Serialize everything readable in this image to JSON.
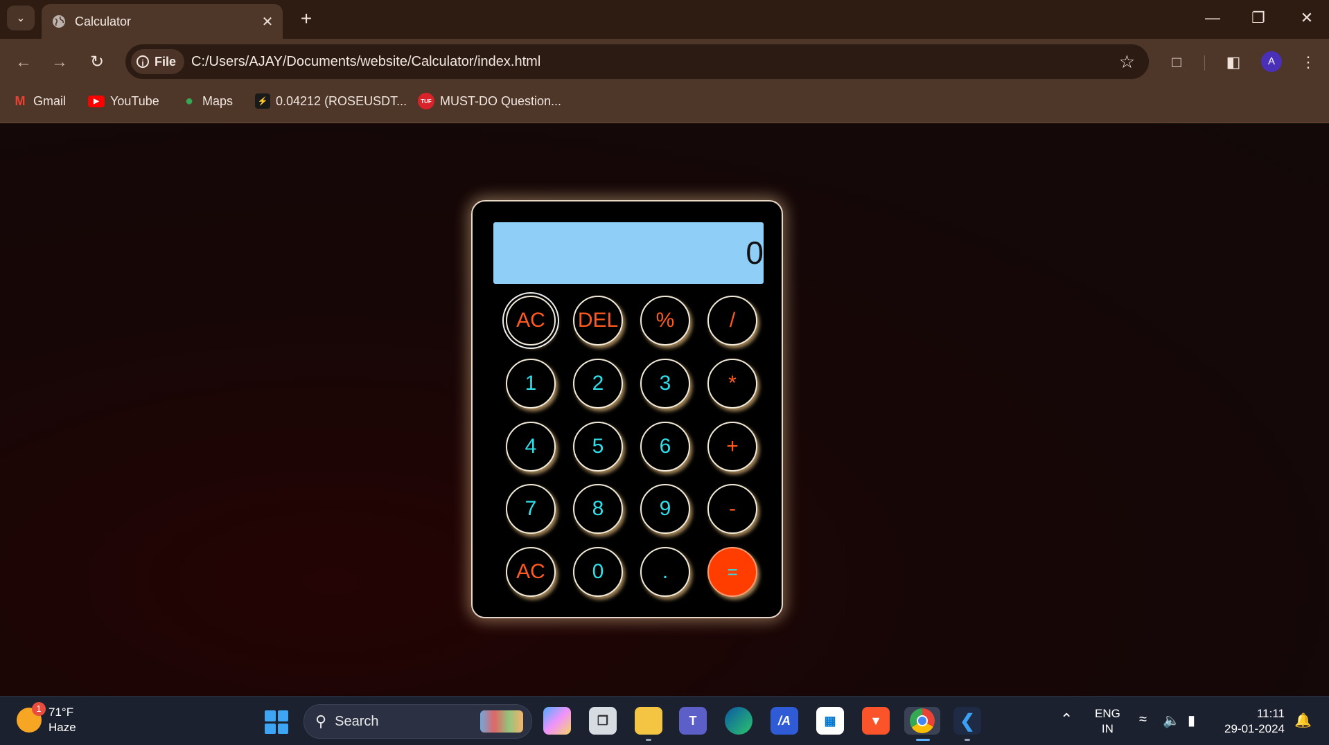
{
  "browser": {
    "tab_title": "Calculator",
    "url_chip": "File",
    "url": "C:/Users/AJAY/Documents/website/Calculator/index.html",
    "avatar_letter": "A",
    "bookmarks": [
      {
        "label": "Gmail"
      },
      {
        "label": "YouTube"
      },
      {
        "label": "Maps"
      },
      {
        "label": "0.04212 (ROSEUSDT..."
      },
      {
        "label": "MUST-DO Question..."
      }
    ]
  },
  "calculator": {
    "display": "0",
    "keys": [
      [
        "AC",
        "DEL",
        "%",
        "/"
      ],
      [
        "1",
        "2",
        "3",
        "*"
      ],
      [
        "4",
        "5",
        "6",
        "+"
      ],
      [
        "7",
        "8",
        "9",
        "-"
      ],
      [
        "AC",
        "0",
        ".",
        "="
      ]
    ],
    "colors": {
      "display_bg": "#8fcff7",
      "number_text": "#2ee0ea",
      "operator_text": "#ff5a1f",
      "equals_bg": "#ff3d00"
    }
  },
  "taskbar": {
    "weather_temp": "71°F",
    "weather_desc": "Haze",
    "weather_badge": "1",
    "search_label": "Search",
    "lang_top": "ENG",
    "lang_bottom": "IN",
    "time": "11:11",
    "date": "29-01-2024"
  }
}
